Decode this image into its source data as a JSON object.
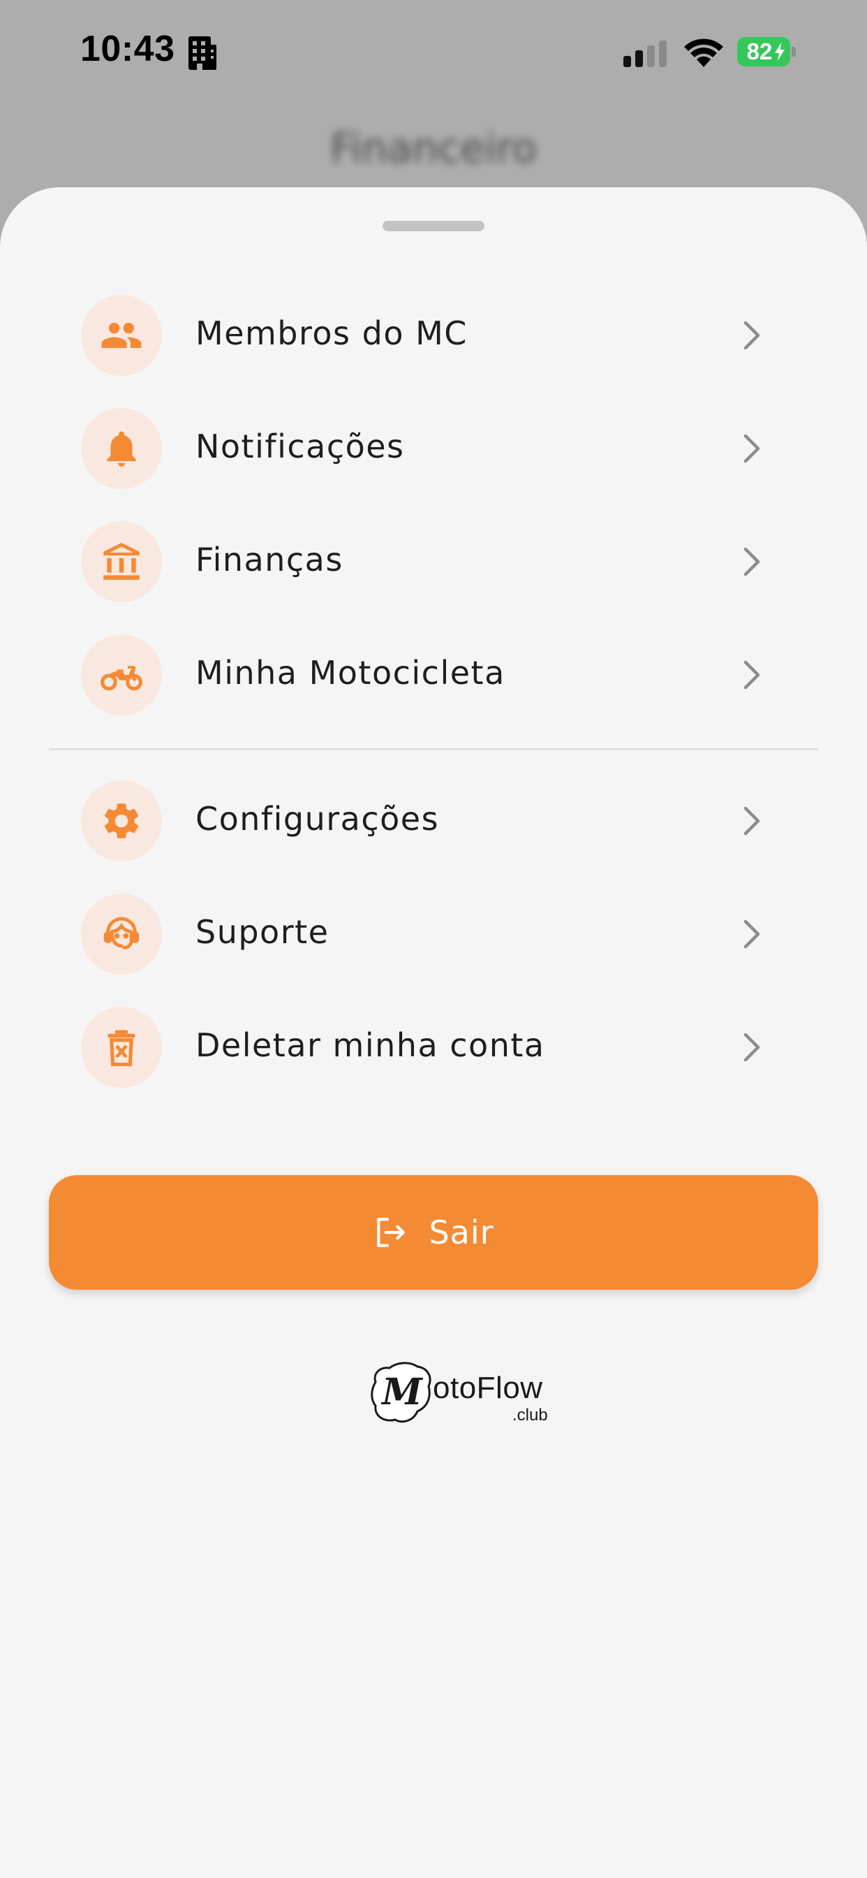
{
  "status_bar": {
    "time": "10:43",
    "battery_level": "82"
  },
  "background": {
    "title": "Financeiro"
  },
  "menu": {
    "primary": [
      {
        "label": "Membros do MC",
        "icon": "group-icon"
      },
      {
        "label": "Notificações",
        "icon": "bell-icon"
      },
      {
        "label": "Finanças",
        "icon": "bank-icon"
      },
      {
        "label": "Minha Motocicleta",
        "icon": "motorcycle-icon"
      }
    ],
    "secondary": [
      {
        "label": "Configurações",
        "icon": "gear-icon"
      },
      {
        "label": "Suporte",
        "icon": "support-agent-icon"
      },
      {
        "label": "Deletar minha conta",
        "icon": "trash-icon"
      }
    ]
  },
  "logout": {
    "label": "Sair",
    "icon": "logout-icon"
  },
  "brand": {
    "name": "otoFlow",
    "mark_letter": "M",
    "suffix": ".club"
  },
  "colors": {
    "accent": "#f58a34",
    "icon_background": "#f8e8df",
    "sheet_background": "#f5f5f5",
    "backdrop": "#adadad",
    "battery": "#35c759"
  }
}
